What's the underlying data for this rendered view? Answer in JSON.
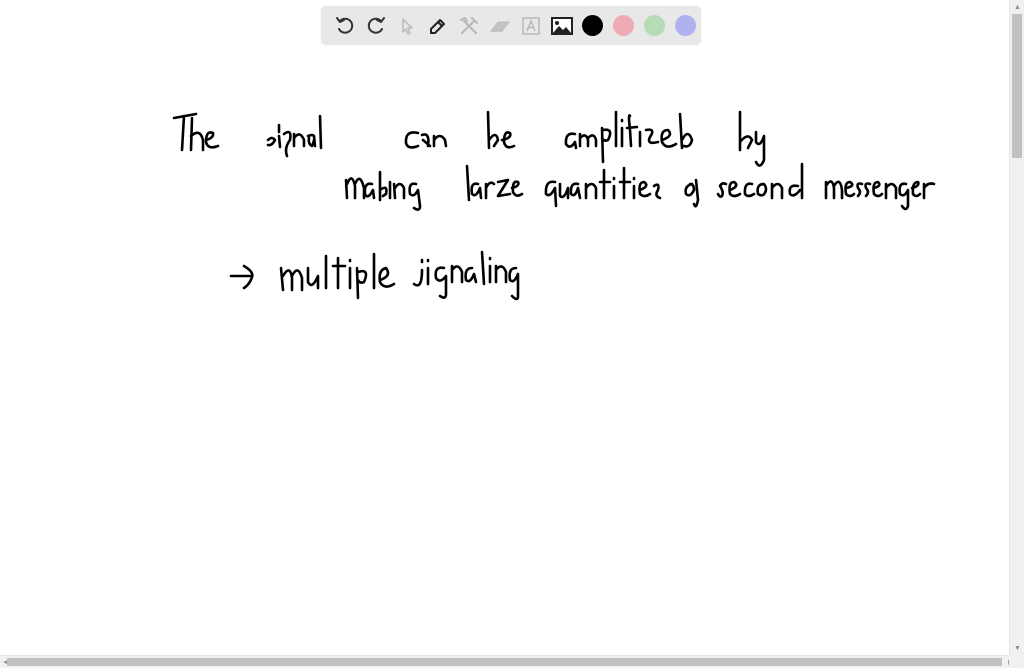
{
  "toolbar": {
    "tools": [
      {
        "name": "undo",
        "icon": "undo-icon",
        "enabled": true
      },
      {
        "name": "redo",
        "icon": "redo-icon",
        "enabled": true
      },
      {
        "name": "select",
        "icon": "cursor-icon",
        "enabled": false
      },
      {
        "name": "pen",
        "icon": "pencil-icon",
        "enabled": true
      },
      {
        "name": "tools",
        "icon": "crossed-tools-icon",
        "enabled": false
      },
      {
        "name": "eraser",
        "icon": "eraser-icon",
        "enabled": false
      },
      {
        "name": "text",
        "icon": "text-box-icon",
        "enabled": false
      },
      {
        "name": "image",
        "icon": "image-icon",
        "enabled": true
      }
    ],
    "colors": [
      {
        "name": "black",
        "hex": "#000000",
        "selected": true
      },
      {
        "name": "pink",
        "hex": "#eeaab5",
        "selected": false
      },
      {
        "name": "green",
        "hex": "#b5dcb4",
        "selected": false
      },
      {
        "name": "purple",
        "hex": "#b1b1f0",
        "selected": false
      }
    ],
    "icon_color": "#333333",
    "disabled_icon_color": "#b8b8b8"
  },
  "note": {
    "lines": [
      "The signal can be amplified by",
      "making large quantities of second messengers",
      "→ multiple signaling"
    ]
  }
}
